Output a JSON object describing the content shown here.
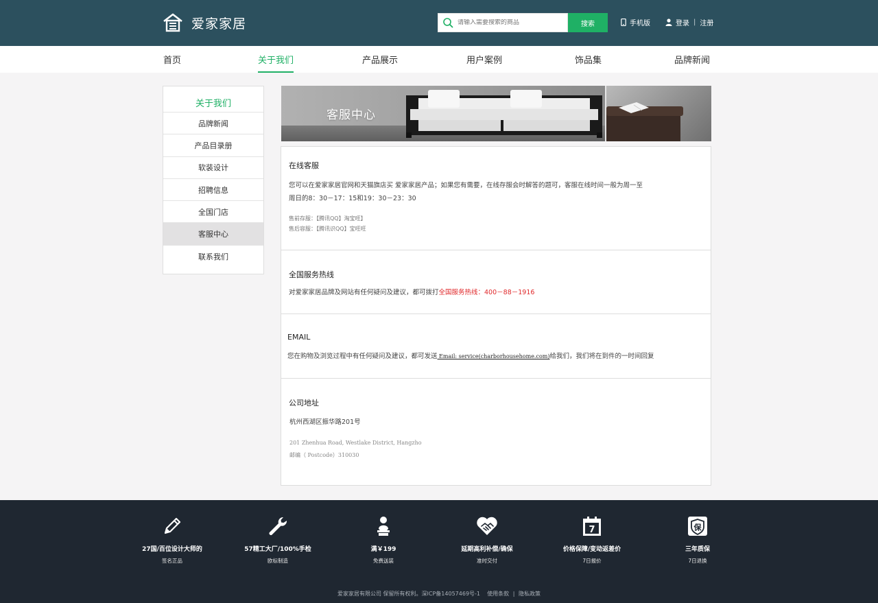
{
  "header": {
    "brand": "爱家家居",
    "search_placeholder": "请输入需要搜索的商品",
    "search_button": "搜索",
    "mobile": "手机版",
    "login": "登录",
    "divider": "|",
    "register": "注册"
  },
  "nav": {
    "items": [
      "首页",
      "关于我们",
      "产品展示",
      "用户案例",
      "饰品集",
      "品牌新闻"
    ],
    "active": "关于我们"
  },
  "sidebar": {
    "title": "关于我们",
    "items": [
      "品牌新闻",
      "产品目录册",
      "软装设计",
      "招聘信息",
      "全国门店",
      "客服中心",
      "联系我们"
    ],
    "active": "客服中心"
  },
  "banner": {
    "title": "客服中心"
  },
  "sections": {
    "online": {
      "title": "在线客服",
      "line1": "您可以在爱家家居官网和天猫旗店买 爱家家居产品；如果您有需要，在线存服会时解答的题可，客服在线时间一般为周一至",
      "line2": "周日的8：30－17：15和19：30－23：30",
      "presale": "售前存服：【腾讯QQ】淘宝旺】",
      "aftersale": "售后容服：【腾讯识QQ】宝旺旺"
    },
    "hotline": {
      "title": "全国服务热线",
      "text": "对爱家家居品牌及网站有任何疑问及建议，都可拨打",
      "highlight": "全国服务热线：400－88－1916"
    },
    "email": {
      "title": "EMAIL",
      "text_before": "您在购物及浏览过程中有任何疑问及建议，都可发送",
      "email_link": " Email: service(charborhousehome.com)",
      "text_after": "给我们，我们将在到件的一时间回复"
    },
    "address": {
      "title": "公司地址",
      "cn": "杭州西湖区振华路201号",
      "en1": "201 Zhenhua Road, Westlake District, Hangzho",
      "en2": "邮编（ Postcode）310030"
    }
  },
  "footer": {
    "features": [
      {
        "icon": "pencil-icon",
        "title": "27国/百位设计大师的",
        "sub": "签名正品"
      },
      {
        "icon": "wrench-icon",
        "title": "57精工大厂/100%手检",
        "sub": "欧标制造"
      },
      {
        "icon": "person-icon",
        "title": "满￥199",
        "sub": "免费送装"
      },
      {
        "icon": "handshake-heart-icon",
        "title": "延期高利补偿/确保",
        "sub": "准时交付"
      },
      {
        "icon": "calendar-icon",
        "title": "价格保障/变动返差价",
        "sub": "7日报价",
        "icon_text": "7"
      },
      {
        "icon": "shield-icon",
        "title": "三年质保",
        "sub": "7日退换",
        "icon_text": "保"
      }
    ],
    "copyright": "爱家家居有限公司 保留所有权利。深ICP备14057469号-1",
    "terms": "使用条款",
    "privacy": "隐私政策",
    "link_sep": "|"
  },
  "colors": {
    "header_bg": "#2c505e",
    "accent": "#1fb065",
    "footer_bg": "#1f2731",
    "highlight_red": "#e0292b"
  }
}
